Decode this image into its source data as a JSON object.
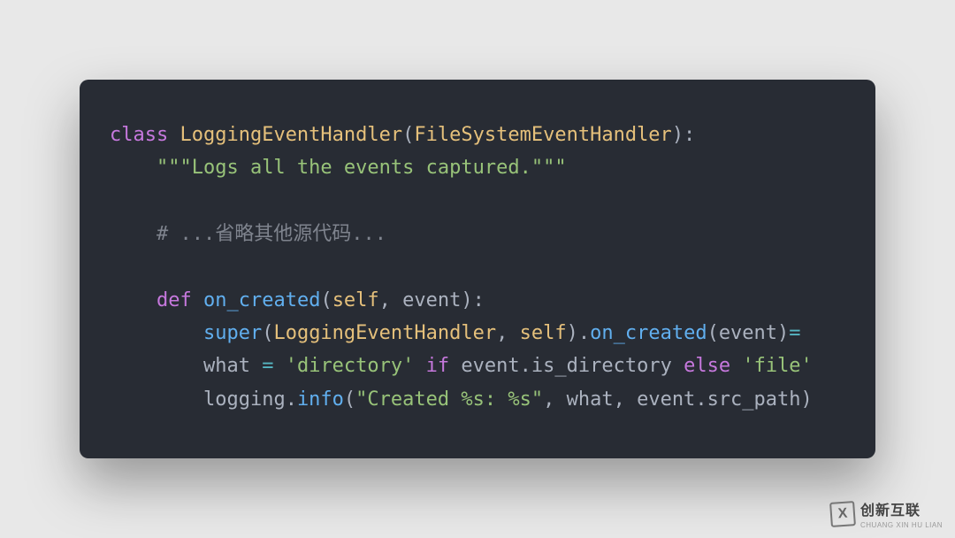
{
  "code": {
    "line1": {
      "kw_class": "class",
      "class_name": "LoggingEventHandler",
      "lparen": "(",
      "base": "FileSystemEventHandler",
      "rparen_colon": "):"
    },
    "line2": {
      "indent": "    ",
      "docstring": "\"\"\"Logs all the events captured.\"\"\""
    },
    "line3": "",
    "line4": {
      "indent": "    ",
      "comment": "# ...省略其他源代码..."
    },
    "line5": "",
    "line6": {
      "indent": "    ",
      "kw_def": "def",
      "fn_name": "on_created",
      "lparen": "(",
      "self": "self",
      "comma": ", ",
      "param": "event",
      "rparen_colon": "):"
    },
    "line7": {
      "indent": "        ",
      "super": "super",
      "lparen1": "(",
      "cls": "LoggingEventHandler",
      "comma": ", ",
      "self": "self",
      "rparen1": ")",
      "dot1": ".",
      "method": "on_created",
      "lparen2": "(",
      "arg": "event",
      "rparen2": ")",
      "eq": "="
    },
    "line8": {
      "indent": "        ",
      "var": "what",
      "assign": " = ",
      "str1": "'directory'",
      "space1": " ",
      "kw_if": "if",
      "space2": " ",
      "obj": "event",
      "dot": ".",
      "prop": "is_directory",
      "space3": " ",
      "kw_else": "else",
      "space4": " ",
      "str2": "'file'"
    },
    "line9": {
      "indent": "        ",
      "mod": "logging",
      "dot": ".",
      "fn": "info",
      "lparen": "(",
      "str": "\"Created %s: %s\"",
      "comma1": ", ",
      "arg1": "what",
      "comma2": ", ",
      "obj": "event",
      "dot2": ".",
      "prop": "src_path",
      "rparen": ")"
    }
  },
  "watermark": {
    "logo_letter": "X",
    "main": "创新互联",
    "sub": "CHUANG XIN HU LIAN"
  }
}
